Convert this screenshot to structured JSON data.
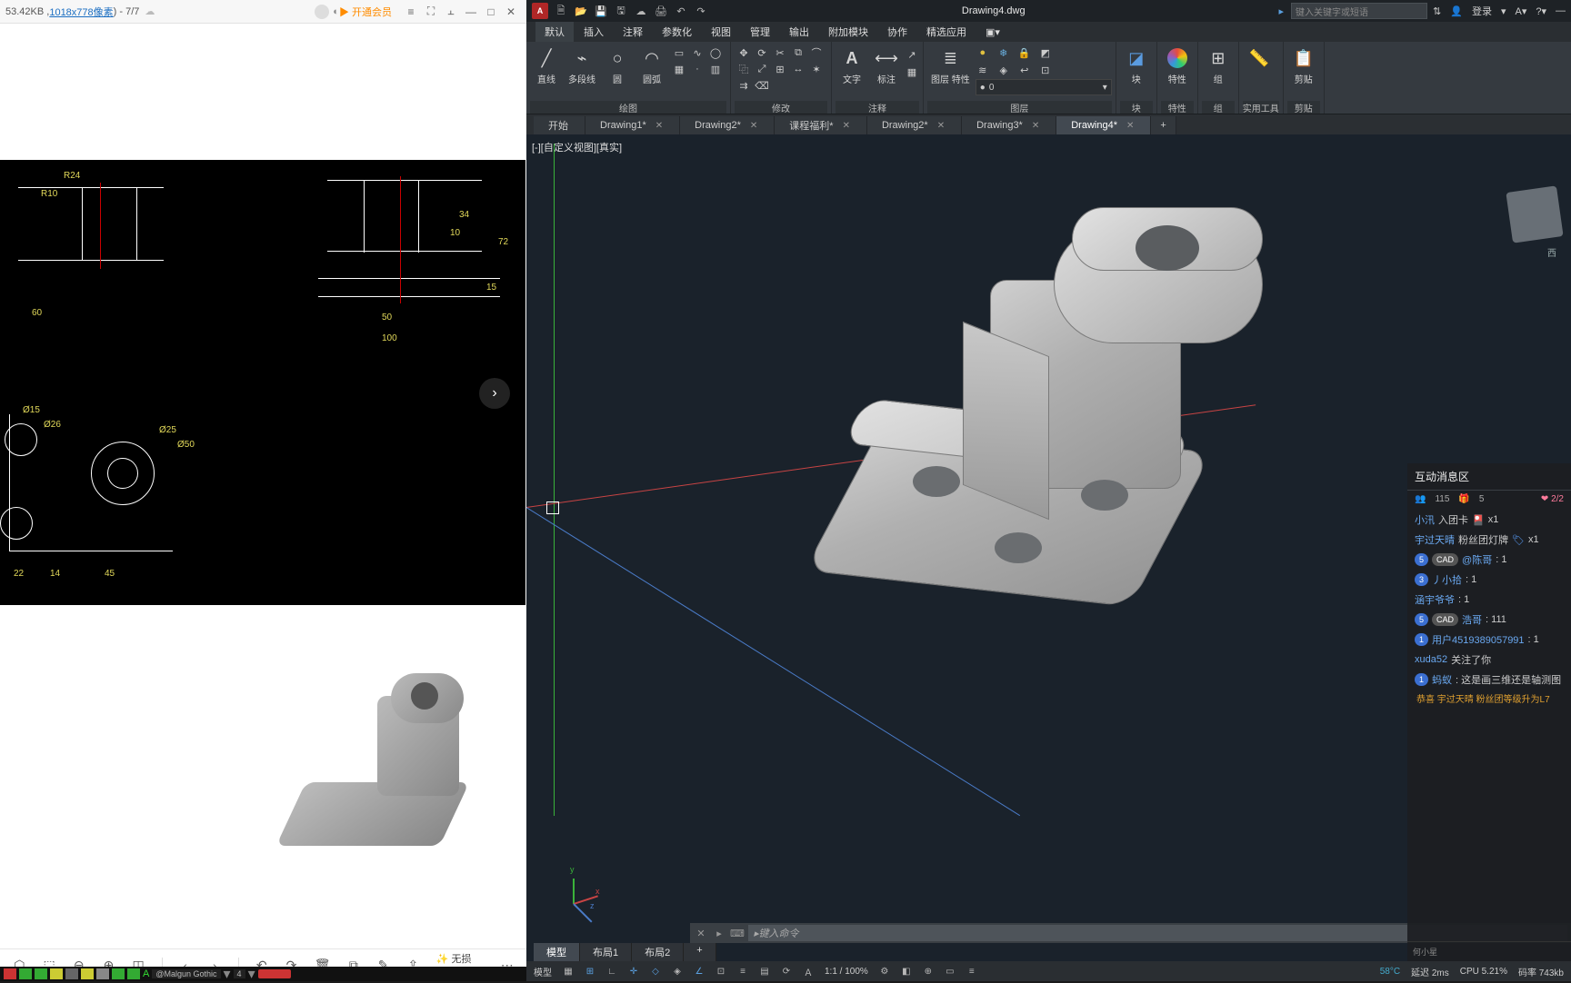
{
  "leftViewer": {
    "fileInfo": "53.42KB ,",
    "resolution": "1018x778像素",
    "pageIndicator": ") - 7/7",
    "vipLabel": "开通会员",
    "zoomLabel": "无损放大",
    "dims": {
      "r24": "R24",
      "r10": "R10",
      "d60": "60",
      "d50": "50",
      "d100": "100",
      "d34": "34",
      "d10": "10",
      "d72": "72",
      "d15": "15",
      "d22": "22",
      "d14": "14",
      "d45": "45",
      "phi15": "Ø15",
      "phi26": "Ø26",
      "phi25": "Ø25",
      "phi50": "Ø50"
    }
  },
  "autocad": {
    "docTitle": "Drawing4.dwg",
    "searchPlaceholder": "键入关键字或短语",
    "loginLabel": "登录",
    "menuTabs": [
      "默认",
      "插入",
      "注释",
      "参数化",
      "视图",
      "管理",
      "输出",
      "附加模块",
      "协作",
      "精选应用"
    ],
    "activeMenu": 0,
    "ribbon": {
      "draw": {
        "label": "绘图",
        "line": "直线",
        "pline": "多段线",
        "circle": "圆",
        "arc": "圆弧"
      },
      "modify": {
        "label": "修改"
      },
      "annot": {
        "label": "注释",
        "text": "文字",
        "dim": "标注"
      },
      "layer": {
        "label": "图层",
        "btn": "图层\n特性",
        "combo": "0"
      },
      "block": {
        "label": "块",
        "btn": "块"
      },
      "props": {
        "label": "特性",
        "btn": "特性"
      },
      "group": {
        "label": "组",
        "btn": "组"
      },
      "util": {
        "label": "实用工具"
      },
      "clip": {
        "label": "剪贴",
        "btn": "剪贴"
      }
    },
    "docTabs": [
      {
        "label": "开始",
        "close": false
      },
      {
        "label": "Drawing1*",
        "close": true
      },
      {
        "label": "Drawing2*",
        "close": true
      },
      {
        "label": "课程福利*",
        "close": true
      },
      {
        "label": "Drawing2*",
        "close": true
      },
      {
        "label": "Drawing3*",
        "close": true
      },
      {
        "label": "Drawing4*",
        "close": true
      }
    ],
    "activeDocTab": 6,
    "viewportLabel": "[-][自定义视图][真实]",
    "viewcubeSide": "西",
    "cmdPlaceholder": "键入命令",
    "modelTabs": [
      "模型",
      "布局1",
      "布局2"
    ],
    "activeModelTab": 0,
    "status": {
      "model": "模型",
      "scale": "1:1 / 100%",
      "temp": "58°C",
      "latency": "延迟 2ms",
      "cpu": "CPU 5.21%",
      "bitrate": "码率 743kb"
    }
  },
  "chat": {
    "title": "互动消息区",
    "viewers": "115",
    "gifts": "5",
    "ratio": "2/2",
    "rows": [
      {
        "badges": [],
        "user": "小汛",
        "text": "入团卡",
        "suffix": "x1"
      },
      {
        "badges": [],
        "user": "宇过天晴",
        "text": "粉丝团灯牌",
        "suffix": "x1"
      },
      {
        "badges": [
          "5",
          "CAD"
        ],
        "user": "@陈哥",
        "msg": ": 1"
      },
      {
        "badges": [
          "3"
        ],
        "user": "丿小拾",
        "msg": ": 1"
      },
      {
        "badges": [],
        "user": "涵宇爷爷",
        "msg": ": 1"
      },
      {
        "badges": [
          "5",
          "CAD"
        ],
        "user": "浩哥",
        "msg": ": 111"
      },
      {
        "badges": [
          "1"
        ],
        "user": "用户4519389057991",
        "msg": ": 1"
      },
      {
        "badges": [],
        "user": "xuda52",
        "msg": " 关注了你"
      },
      {
        "badges": [
          "1"
        ],
        "user": "蚂蚁",
        "msg": ": 这是画三维还是轴测图"
      }
    ],
    "sys": "恭喜 宇过天晴 粉丝团等级升为L7",
    "foot": "何小星"
  },
  "osbar": {
    "font": "@Malgun Gothic",
    "num": "4"
  }
}
